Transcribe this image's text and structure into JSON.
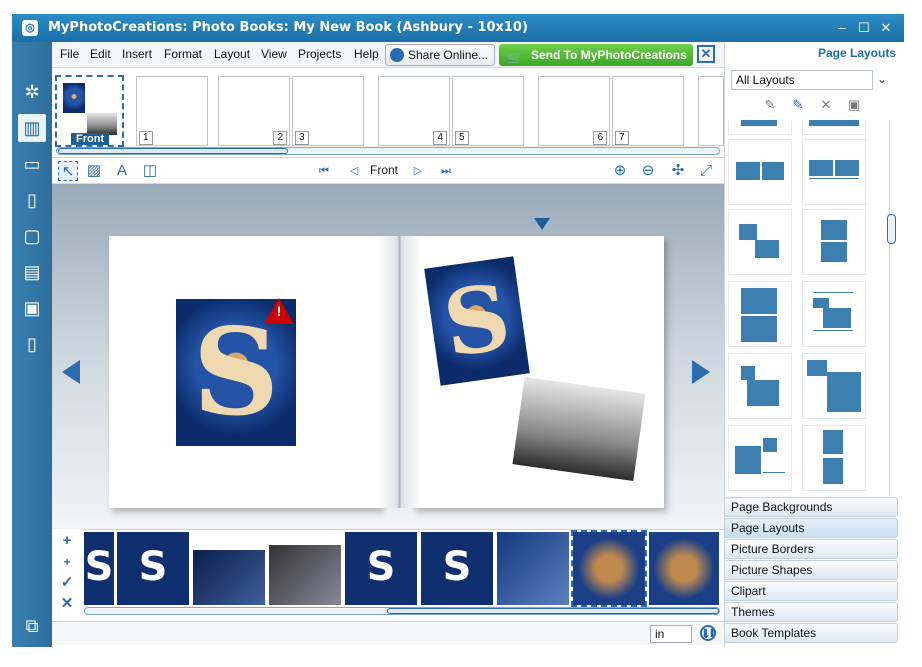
{
  "window": {
    "title": "MyPhotoCreations: Photo Books: My New Book (Ashbury - 10x10)"
  },
  "menu": [
    "File",
    "Edit",
    "Insert",
    "Format",
    "Layout",
    "View",
    "Projects",
    "Help"
  ],
  "toolbar": {
    "share_label": "Share Online...",
    "send_label": "Send To MyPhotoCreations"
  },
  "pages": {
    "front_label": "Front",
    "numbers": [
      "1",
      "2",
      "3",
      "4",
      "5",
      "6",
      "7"
    ]
  },
  "nav": {
    "current_page": "Front"
  },
  "status": {
    "unit": "in"
  },
  "panel": {
    "title": "Page Layouts",
    "dropdown_value": "All Layouts",
    "tabs": [
      "Page Backgrounds",
      "Page Layouts",
      "Picture Borders",
      "Picture Shapes",
      "Clipart",
      "Themes",
      "Book Templates"
    ],
    "active_tab": "Page Layouts"
  },
  "colors": {
    "accent": "#2a6cae",
    "title": "#1a6fa6",
    "send": "#3ba628",
    "warning": "#cc0000"
  },
  "icons": [
    "app-icon",
    "settings-icon",
    "book-icon",
    "page-icon",
    "globe-icon",
    "cart-icon",
    "pointer-icon",
    "add-photo-icon",
    "add-text-icon",
    "add-frame-icon",
    "first-page-icon",
    "prev-page-icon",
    "next-page-icon",
    "last-page-icon",
    "zoom-in-icon",
    "zoom-out-icon",
    "fit-icon",
    "expand-icon",
    "warning-icon",
    "pencil-icon",
    "edit-icon",
    "delete-icon",
    "save-icon",
    "pause-icon"
  ]
}
